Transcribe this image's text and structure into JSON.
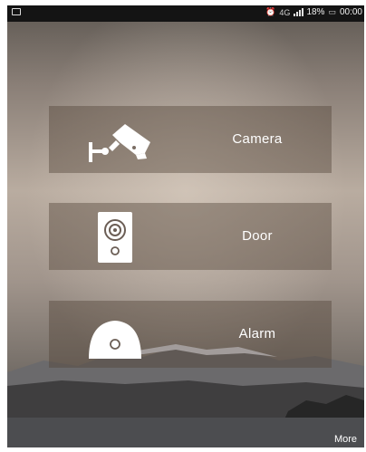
{
  "status_bar": {
    "battery": "18%",
    "time": "00:00",
    "network": "4G",
    "icons": [
      "notification-icon",
      "alarm-clock-icon",
      "signal-icon",
      "battery-icon"
    ]
  },
  "menu": {
    "items": [
      {
        "label": "Camera",
        "icon": "security-camera-icon"
      },
      {
        "label": "Door",
        "icon": "doorbell-icon"
      },
      {
        "label": "Alarm",
        "icon": "alarm-sensor-icon"
      }
    ]
  },
  "footer": {
    "more_label": "More"
  },
  "colors": {
    "card_overlay": "#50423899",
    "status_bar": "#141414",
    "text": "#ffffff"
  }
}
